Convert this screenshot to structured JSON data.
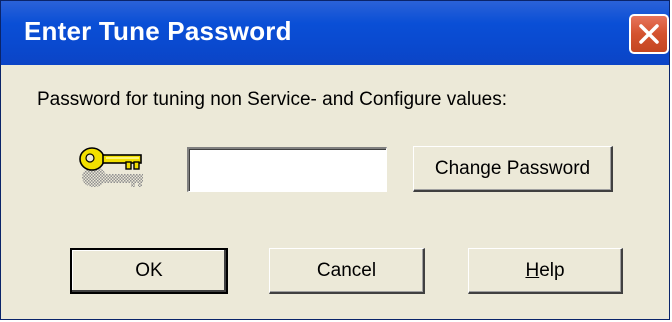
{
  "window": {
    "title": "Enter Tune Password",
    "close_icon": "close-icon"
  },
  "dialog": {
    "prompt_label": "Password for tuning non Service- and Configure values:",
    "key_icon": "key-icon",
    "password": {
      "value": "",
      "placeholder": ""
    },
    "change_password_label": "Change Password"
  },
  "buttons": {
    "ok_label": "OK",
    "cancel_label": "Cancel",
    "help_label": "Help"
  },
  "colors": {
    "titlebar": "#0a4ad0",
    "dialog_background": "#ece9d8",
    "close_button": "#d4522e",
    "key": "#f2e000"
  }
}
